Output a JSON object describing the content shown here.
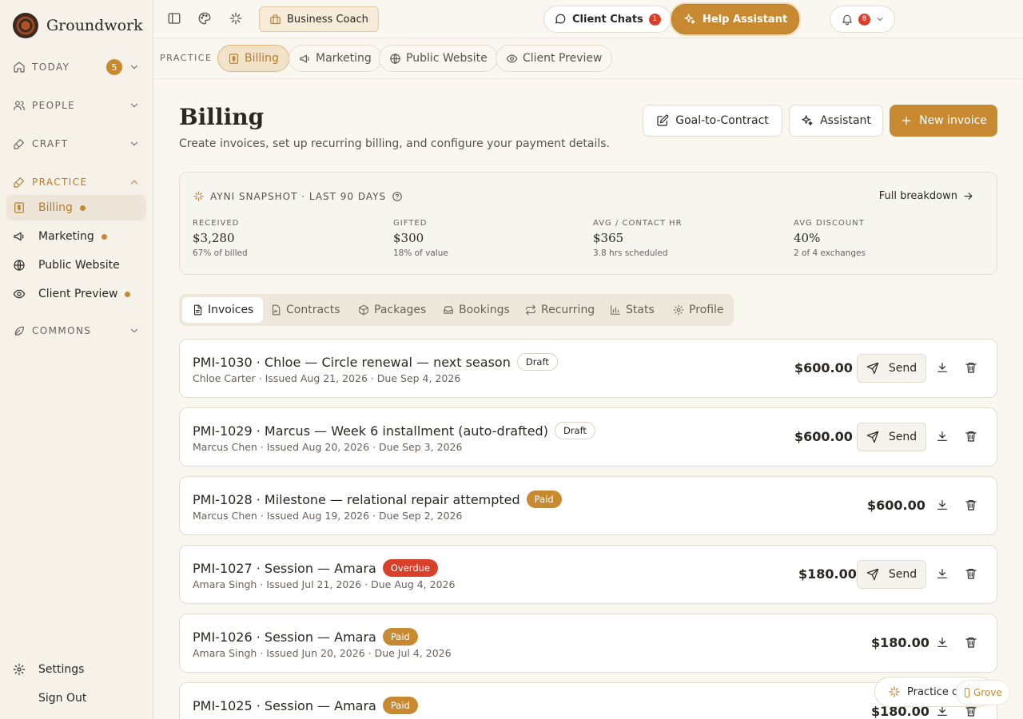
{
  "app": {
    "name": "Groundwork"
  },
  "sidebar": {
    "today": {
      "label": "TODAY",
      "count": "5"
    },
    "people": {
      "label": "PEOPLE"
    },
    "craft": {
      "label": "CRAFT"
    },
    "practice": {
      "label": "PRACTICE"
    },
    "items": [
      {
        "label": "Billing"
      },
      {
        "label": "Marketing"
      },
      {
        "label": "Public Website"
      },
      {
        "label": "Client Preview"
      }
    ],
    "commons": {
      "label": "COMMONS"
    },
    "settings": "Settings",
    "signout": "Sign Out"
  },
  "topbar": {
    "business_coach": "Business Coach",
    "client_chats": "Client Chats",
    "client_chats_count": "1",
    "help_assistant": "Help Assistant",
    "notifications_count": "8"
  },
  "subnav": {
    "label": "PRACTICE",
    "tabs": [
      "Billing",
      "Marketing",
      "Public Website",
      "Client Preview"
    ]
  },
  "page": {
    "title": "Billing",
    "subtitle": "Create invoices, set up recurring billing, and configure your payment details.",
    "goal_btn": "Goal-to-Contract",
    "assistant_btn": "Assistant",
    "new_invoice_btn": "New invoice"
  },
  "snapshot": {
    "heading": "AYNI SNAPSHOT · LAST 90 DAYS",
    "full_breakdown": "Full breakdown",
    "metrics": [
      {
        "label": "RECEIVED",
        "value": "$3,280",
        "note": "67% of billed"
      },
      {
        "label": "GIFTED",
        "value": "$300",
        "note": "18% of value"
      },
      {
        "label": "AVG / CONTACT HR",
        "value": "$365",
        "note": "3.8 hrs scheduled"
      },
      {
        "label": "AVG DISCOUNT",
        "value": "40%",
        "note": "2 of 4 exchanges"
      }
    ]
  },
  "segments": [
    "Invoices",
    "Contracts",
    "Packages",
    "Bookings",
    "Recurring",
    "Stats",
    "Profile"
  ],
  "invoices": [
    {
      "title": "PMI-1030 · Chloe — Circle renewal — next season",
      "status": "Draft",
      "meta": "Chloe Carter · Issued Aug 21, 2026 · Due Sep 4, 2026",
      "amount": "$600.00",
      "send": "Send"
    },
    {
      "title": "PMI-1029 · Marcus — Week 6 installment (auto-drafted)",
      "status": "Draft",
      "meta": "Marcus Chen · Issued Aug 20, 2026 · Due Sep 3, 2026",
      "amount": "$600.00",
      "send": "Send"
    },
    {
      "title": "PMI-1028 · Milestone — relational repair attempted",
      "status": "Paid",
      "meta": "Marcus Chen · Issued Aug 19, 2026 · Due Sep 2, 2026",
      "amount": "$600.00"
    },
    {
      "title": "PMI-1027 · Session — Amara",
      "status": "Overdue",
      "meta": "Amara Singh · Issued Jul 21, 2026 · Due Aug 4, 2026",
      "amount": "$180.00",
      "send": "Send"
    },
    {
      "title": "PMI-1026 · Session — Amara",
      "status": "Paid",
      "meta": "Amara Singh · Issued Jun 20, 2026 · Due Jul 4, 2026",
      "amount": "$180.00"
    },
    {
      "title": "PMI-1025 · Session — Amara",
      "status": "Paid",
      "meta": "",
      "amount": "$180.00"
    }
  ],
  "floating": {
    "practice": "Practice c",
    "grove": "Grove"
  },
  "colors": {
    "accent": "#c88a30",
    "overdue": "#d8402c",
    "background": "#faf7f1"
  }
}
